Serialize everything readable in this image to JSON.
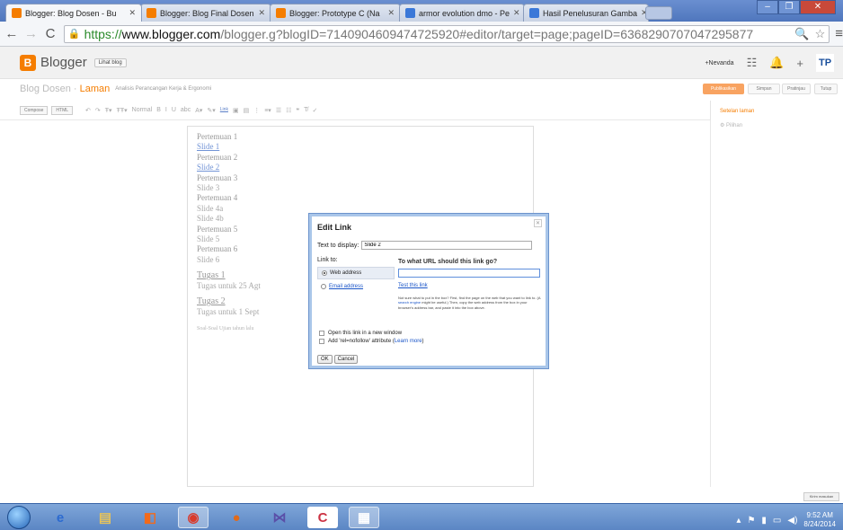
{
  "tabs": [
    {
      "title": "Blogger: Blog Dosen - Bu"
    },
    {
      "title": "Blogger: Blog Final Dosen"
    },
    {
      "title": "Blogger: Prototype C (Na"
    },
    {
      "title": "armor evolution dmo - Pe"
    },
    {
      "title": "Hasil Penelusuran Gamba"
    }
  ],
  "address": {
    "scheme": "https://",
    "host": "www.blogger.com",
    "path": "/blogger.g?blogID=7140904609474725920#editor/target=page;pageID=6368290707047295877"
  },
  "blogger": {
    "brand": "Blogger",
    "view_blog": "Lihat blog",
    "user": "+Nevanda",
    "avatar": "TP"
  },
  "editor": {
    "blog_name": "Blog Dosen",
    "separator": " · ",
    "page_label": "Laman",
    "post_title": "Analisis Perancangan Kerja & Ergonomi",
    "publish": "Publikasikan",
    "save": "Simpan",
    "preview": "Pratinjau",
    "close": "Tutup"
  },
  "format": {
    "compose": "Compose",
    "html": "HTML",
    "font_size": "Normal",
    "link": "Link"
  },
  "sidebar": {
    "page_settings": "Setelan laman",
    "options": "Pilihan"
  },
  "content": {
    "lines": [
      {
        "text": "Pertemuan 1",
        "kind": "hd"
      },
      {
        "text": "Slide 1",
        "kind": "lnk"
      },
      {
        "text": "Pertemuan 2",
        "kind": "hd"
      },
      {
        "text": "Slide 2",
        "kind": "lnk"
      },
      {
        "text": "Pertemuan 3",
        "kind": "hd"
      },
      {
        "text": "Slide 3",
        "kind": "plain"
      },
      {
        "text": "Pertemuan 4",
        "kind": "hd"
      },
      {
        "text": "Slide 4a",
        "kind": "plain"
      },
      {
        "text": "Slide 4b",
        "kind": "plain"
      },
      {
        "text": "Pertemuan 5",
        "kind": "hd"
      },
      {
        "text": "Slide 5",
        "kind": "plain"
      },
      {
        "text": "Pertemuan 6",
        "kind": "hd"
      },
      {
        "text": "Slide 6",
        "kind": "plain"
      }
    ],
    "tugas1": "Tugas 1",
    "tugas1_desc": "Tugas untuk 25 Agt",
    "tugas2": "Tugas 2",
    "tugas2_desc": "Tugas untuk 1 Sept",
    "exam": "Soal-Soal Ujian tahun lalu"
  },
  "dialog": {
    "title": "Edit Link",
    "text_label": "Text to display:",
    "text_value": "Slide 2",
    "link_to": "Link to:",
    "web_address": "Web address",
    "email_address": "Email address",
    "question": "To what URL should this link go?",
    "test_link": "Test this link",
    "help_a": "Not sure what to put in the box? First, find the page on the web that you want to link to. (A ",
    "help_link": "search engine",
    "help_b": " might be useful.) Then, copy the web address from the box in your browser's address bar, and paste it into the box above.",
    "new_window": "Open this link in a new window",
    "nofollow_a": "Add 'rel=nofollow' attribute (",
    "nofollow_link": "Learn more",
    "nofollow_b": ")",
    "ok": "OK",
    "cancel": "Cancel"
  },
  "feedback": "Kirim masukan",
  "clock": {
    "time": "9:52 AM",
    "date": "8/24/2014"
  },
  "colors": {
    "accent": "#f57d00",
    "link": "#1a55c8"
  }
}
